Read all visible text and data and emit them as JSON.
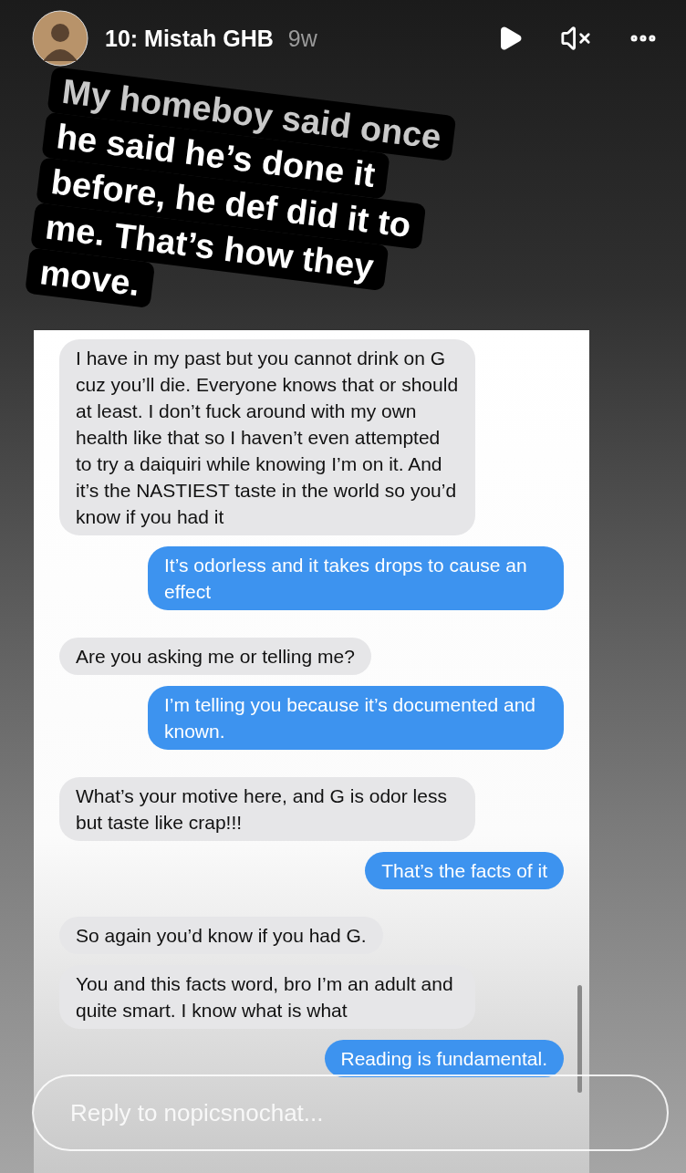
{
  "story_header": {
    "username": "10: Mistah GHB",
    "age": "9w"
  },
  "caption": {
    "lines": [
      "My homeboy said once",
      "he said he’s done it",
      "before, he def did it to",
      "me. That’s how they",
      "move."
    ]
  },
  "messages": [
    {
      "kind": "received",
      "text": "I have in my past but you cannot drink on G cuz you’ll die. Everyone knows that or should at least. I don’t fuck around with my own health like that so I haven’t even attempted to try a daiquiri while knowing I’m on it. And it’s the NASTIEST taste in the world so you’d know if you had it"
    },
    {
      "kind": "sent",
      "text": "It’s odorless and it takes drops to cause an effect"
    },
    {
      "kind": "received",
      "text": "Are you asking me or telling me?"
    },
    {
      "kind": "sent",
      "text": "I’m telling you because it’s documented and known."
    },
    {
      "kind": "received",
      "text": "What’s your motive here, and G is odor less but taste like crap!!!"
    },
    {
      "kind": "sent",
      "text": "That’s the facts of it"
    },
    {
      "kind": "received",
      "text": "So again you’d know if you had G."
    },
    {
      "kind": "received",
      "text": "You and this facts word, bro I’m an adult and quite smart. I know what is what"
    },
    {
      "kind": "sent",
      "text": "Reading is fundamental."
    }
  ],
  "reply_field": {
    "placeholder": "Reply to nopicsnochat..."
  }
}
